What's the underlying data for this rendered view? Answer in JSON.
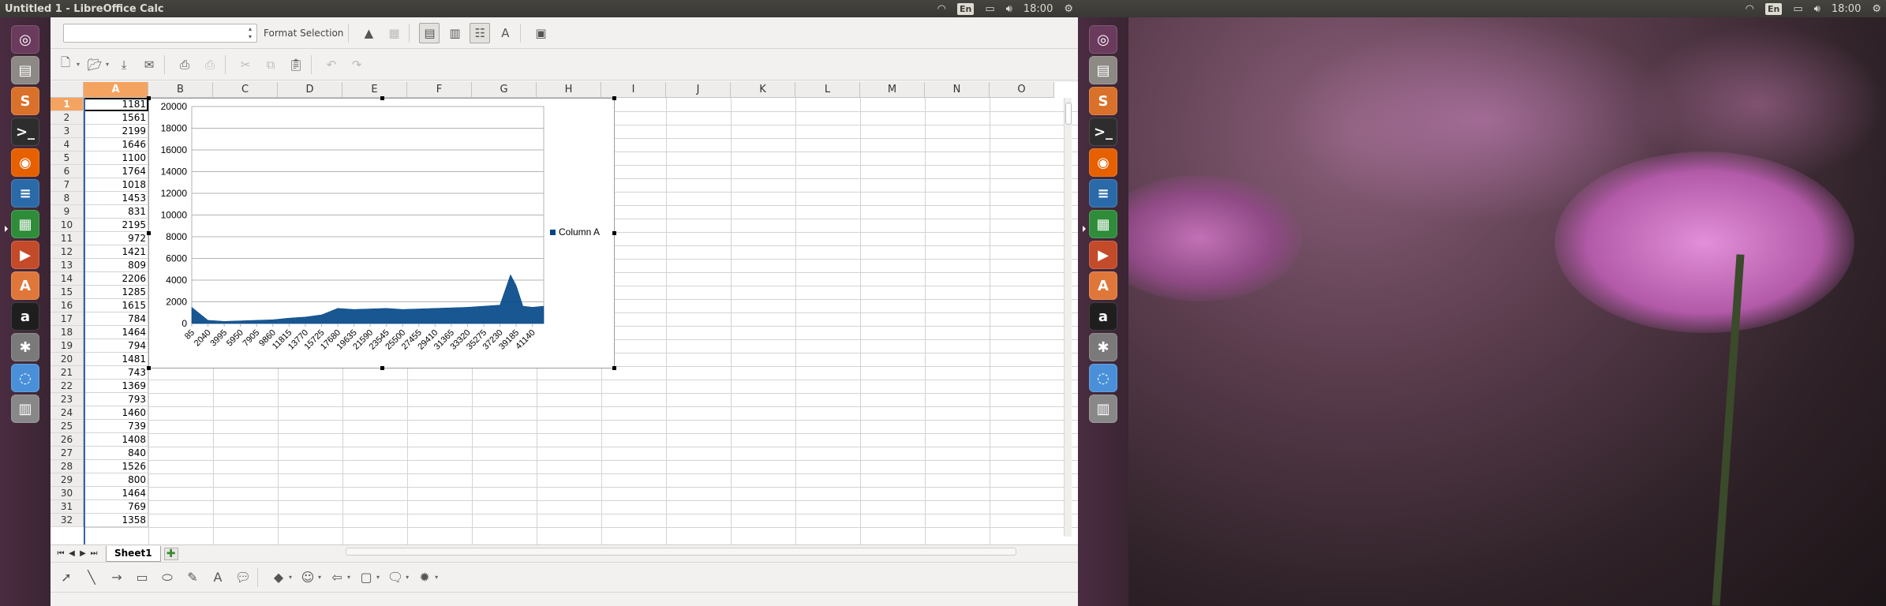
{
  "panel": {
    "window_title": "Untitled 1 - LibreOffice Calc",
    "keyboard": "En",
    "clock": "18:00"
  },
  "panel_right": {
    "keyboard": "En",
    "clock": "18:00"
  },
  "launcher": {
    "items": [
      "ubuntu-dash",
      "files",
      "sublime-text",
      "terminal",
      "firefox",
      "writer",
      "calc",
      "impress",
      "software-center",
      "amazon",
      "system-settings",
      "chromium",
      "scanner"
    ]
  },
  "toolbar": {
    "format_selection_label": "Format Selection"
  },
  "sheet": {
    "columns": [
      "A",
      "B",
      "C",
      "D",
      "E",
      "F",
      "G",
      "H",
      "I",
      "J",
      "K",
      "L",
      "M",
      "N",
      "O"
    ],
    "active_cell": "A1",
    "rows": [
      {
        "n": "1",
        "a": "1181"
      },
      {
        "n": "2",
        "a": "1561"
      },
      {
        "n": "3",
        "a": "2199"
      },
      {
        "n": "4",
        "a": "1646"
      },
      {
        "n": "5",
        "a": "1100"
      },
      {
        "n": "6",
        "a": "1764"
      },
      {
        "n": "7",
        "a": "1018"
      },
      {
        "n": "8",
        "a": "1453"
      },
      {
        "n": "9",
        "a": "831"
      },
      {
        "n": "10",
        "a": "2195"
      },
      {
        "n": "11",
        "a": "972"
      },
      {
        "n": "12",
        "a": "1421"
      },
      {
        "n": "13",
        "a": "809"
      },
      {
        "n": "14",
        "a": "2206"
      },
      {
        "n": "15",
        "a": "1285"
      },
      {
        "n": "16",
        "a": "1615"
      },
      {
        "n": "17",
        "a": "784"
      },
      {
        "n": "18",
        "a": "1464"
      },
      {
        "n": "19",
        "a": "794"
      },
      {
        "n": "20",
        "a": "1481"
      },
      {
        "n": "21",
        "a": "743"
      },
      {
        "n": "22",
        "a": "1369"
      },
      {
        "n": "23",
        "a": "793"
      },
      {
        "n": "24",
        "a": "1460"
      },
      {
        "n": "25",
        "a": "739"
      },
      {
        "n": "26",
        "a": "1408"
      },
      {
        "n": "27",
        "a": "840"
      },
      {
        "n": "28",
        "a": "1526"
      },
      {
        "n": "29",
        "a": "800"
      },
      {
        "n": "30",
        "a": "1464"
      },
      {
        "n": "31",
        "a": "769"
      },
      {
        "n": "32",
        "a": "1358"
      }
    ],
    "tab_name": "Sheet1"
  },
  "chart_data": {
    "type": "area",
    "title": "",
    "xlabel": "",
    "ylabel": "",
    "ylim": [
      0,
      20000
    ],
    "yticks": [
      "20000",
      "18000",
      "16000",
      "14000",
      "12000",
      "10000",
      "8000",
      "6000",
      "4000",
      "2000",
      "0"
    ],
    "xticks": [
      "85",
      "2040",
      "3995",
      "5950",
      "7905",
      "9860",
      "11815",
      "13770",
      "15725",
      "17680",
      "19635",
      "21590",
      "23545",
      "25500",
      "27455",
      "29410",
      "31365",
      "33320",
      "35275",
      "37230",
      "39185",
      "41140"
    ],
    "legend": "right",
    "series": [
      {
        "name": "Column A",
        "color": "#004586",
        "x": [
          85,
          2040,
          3995,
          5950,
          7905,
          9860,
          11815,
          13770,
          15725,
          17680,
          19635,
          21590,
          23545,
          25500,
          27455,
          29410,
          31365,
          33320,
          35275,
          37230,
          38500,
          39185,
          40000,
          41140,
          42500
        ],
        "values": [
          1500,
          300,
          200,
          250,
          300,
          350,
          500,
          600,
          800,
          1400,
          1300,
          1350,
          1400,
          1300,
          1350,
          1400,
          1450,
          1500,
          1600,
          1700,
          4500,
          3500,
          1600,
          1500,
          1600
        ]
      }
    ]
  },
  "colors": {
    "selection_header": "#f4a460",
    "series_color": "#004586"
  }
}
